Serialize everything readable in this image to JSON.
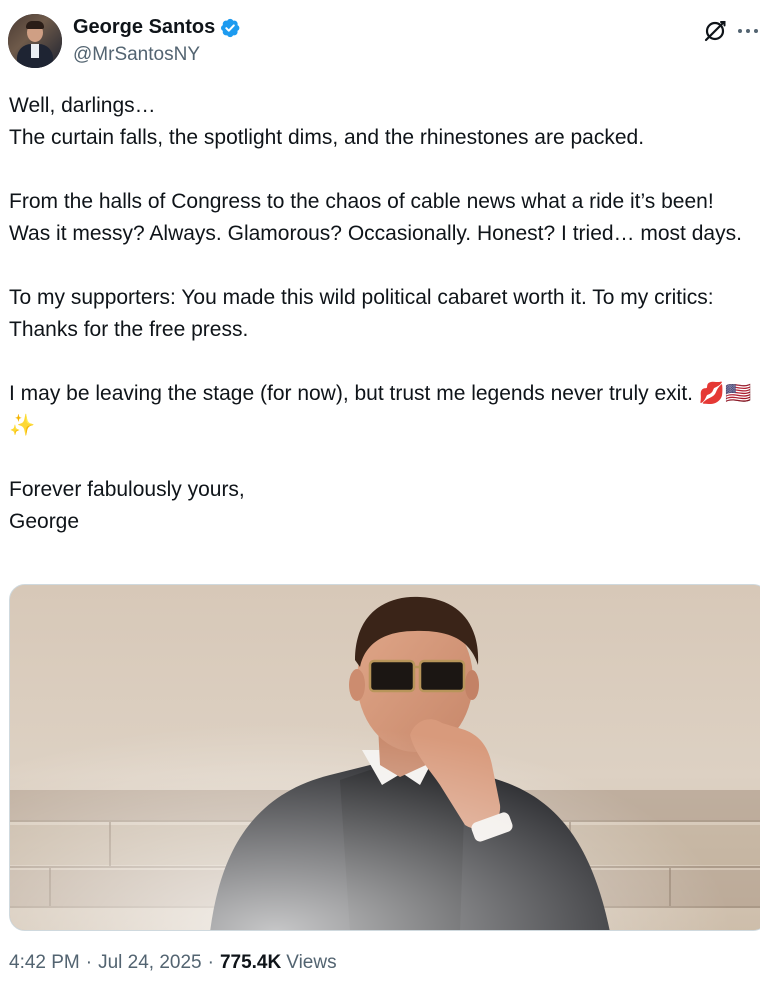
{
  "author": {
    "display_name": "George Santos",
    "handle": "@MrSantosNY",
    "verified": true,
    "avatar_icon": "profile-photo"
  },
  "actions": {
    "grok_icon": "grok-icon",
    "more_icon": "more-options-icon"
  },
  "post": {
    "text": "Well, darlings…\nThe curtain falls, the spotlight dims, and the rhinestones are packed.\n\nFrom the halls of Congress to the chaos of cable news what a ride it’s been! Was it messy? Always. Glamorous? Occasionally. Honest? I tried… most days.\n\nTo my supporters: You made this wild political cabaret worth it. To my critics: Thanks for the free press.\n\nI may be leaving the stage (for now), but trust me legends never truly exit. 💋🇺🇸✨\n\nForever fabulously yours,\nGeorge"
  },
  "media": {
    "type": "photo"
  },
  "meta": {
    "time": "4:42 PM",
    "separator": "·",
    "date": "Jul 24, 2025",
    "views_count": "775.4K",
    "views_label": "Views"
  },
  "colors": {
    "verified_blue": "#1d9bf0",
    "secondary_text": "#536471",
    "primary_text": "#0f1419",
    "border": "#cfd9de"
  }
}
